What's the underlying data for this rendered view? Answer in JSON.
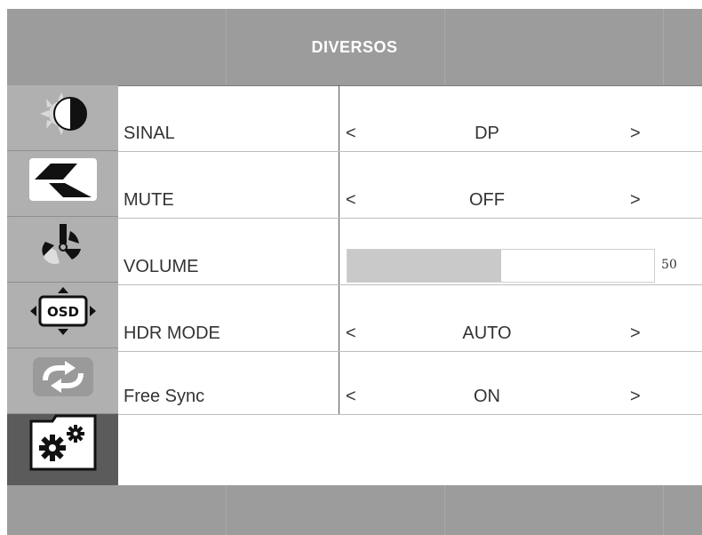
{
  "header": {
    "title": "DIVERSOS"
  },
  "sidebar": {
    "items": [
      {
        "icon": "brightness-contrast-icon",
        "active": false
      },
      {
        "icon": "image-geometry-icon",
        "active": false
      },
      {
        "icon": "color-fan-icon",
        "active": false
      },
      {
        "icon": "osd-settings-icon",
        "active": false
      },
      {
        "icon": "reset-arrows-icon",
        "active": false
      },
      {
        "icon": "misc-gears-folder-icon",
        "active": true
      }
    ]
  },
  "menu": {
    "left_arrow": "<",
    "right_arrow": ">",
    "rows": [
      {
        "label": "SINAL",
        "value": "DP"
      },
      {
        "label": "MUTE",
        "value": "OFF"
      },
      {
        "label": "VOLUME",
        "value": "50",
        "level_percent": 50
      },
      {
        "label": "HDR MODE",
        "value": "AUTO"
      },
      {
        "label": "Free Sync",
        "value": "ON"
      }
    ]
  },
  "colors": {
    "panel_gray": "#9c9c9c",
    "active_item": "#5b5b5b",
    "title_text": "#ffffff"
  }
}
